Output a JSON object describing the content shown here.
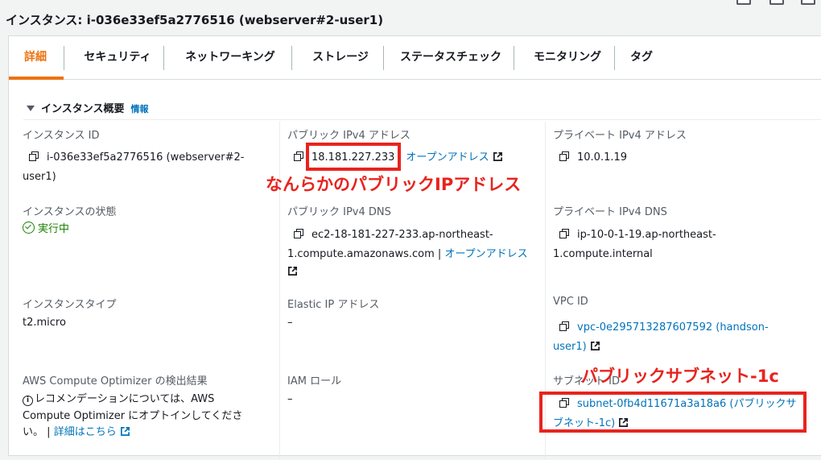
{
  "header": {
    "title": "インスタンス: i-036e33ef5a2776516 (webserver#2-user1)"
  },
  "tabs": [
    "詳細",
    "セキュリティ",
    "ネットワーキング",
    "ストレージ",
    "ステータスチェック",
    "モニタリング",
    "タグ"
  ],
  "section": {
    "title": "インスタンス概要",
    "info": "情報"
  },
  "fields": {
    "instance_id": {
      "label": "インスタンス ID",
      "value_line1": "i-036e33ef5a2776516 (webserver#2-",
      "value_line2": "user1)"
    },
    "public_ipv4": {
      "label": "パブリック IPv4 アドレス",
      "value": "18.181.227.233",
      "link": "オープンアドレス"
    },
    "private_ipv4": {
      "label": "プライベート IPv4 アドレス",
      "value": "10.0.1.19"
    },
    "instance_state": {
      "label": "インスタンスの状態",
      "value": "実行中"
    },
    "public_dns": {
      "label": "パブリック IPv4 DNS",
      "value_line1": "ec2-18-181-227-233.ap-northeast-",
      "value_line2": "1.compute.amazonaws.com",
      "separator": "|",
      "link": "オープンアドレス"
    },
    "private_dns": {
      "label": "プライベート IPv4 DNS",
      "value_line1": "ip-10-0-1-19.ap-northeast-",
      "value_line2": "1.compute.internal"
    },
    "instance_type": {
      "label": "インスタンスタイプ",
      "value": "t2.micro"
    },
    "elastic_ip": {
      "label": "Elastic IP アドレス",
      "value": "–"
    },
    "vpc_id": {
      "label": "VPC ID",
      "value_line1": "vpc-0e295713287607592 (handson-",
      "value_line2": "user1)"
    },
    "optimizer": {
      "label": "AWS Compute Optimizer の検出結果",
      "line1": "レコメンデーションについては、AWS",
      "line2": "Compute Optimizer にオプトインしてくださ",
      "line3_pre": "い。",
      "separator": "|",
      "link": "詳細はこちら"
    },
    "iam_role": {
      "label": "IAM ロール",
      "value": "–"
    },
    "subnet_id": {
      "label": "サブネット ID",
      "value_line1": "subnet-0fb4d11671a3a18a6 (パブリックサ",
      "value_line2": "ブネット-1c)"
    }
  },
  "annotations": {
    "public_ip": "なんらかのパブリックIPアドレス",
    "subnet": "パブリックサブネット-1c"
  },
  "colors": {
    "accent": "#ec7211",
    "link": "#0073bb",
    "success": "#1d8102",
    "annotation": "#e8231e"
  }
}
